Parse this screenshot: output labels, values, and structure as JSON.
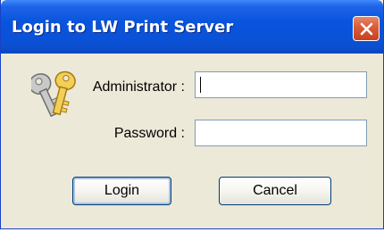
{
  "window": {
    "title": "Login to LW Print Server",
    "close_icon": "close-icon"
  },
  "form": {
    "administrator_label": "Administrator :",
    "administrator_value": "",
    "password_label": "Password :",
    "password_value": ""
  },
  "buttons": {
    "login_label": "Login",
    "cancel_label": "Cancel"
  },
  "icons": {
    "keys": "keys-icon"
  },
  "colors": {
    "titlebar": "#0855dd",
    "close": "#d85c38",
    "dialog_bg": "#ece9d8",
    "field_border": "#7f9db9"
  }
}
